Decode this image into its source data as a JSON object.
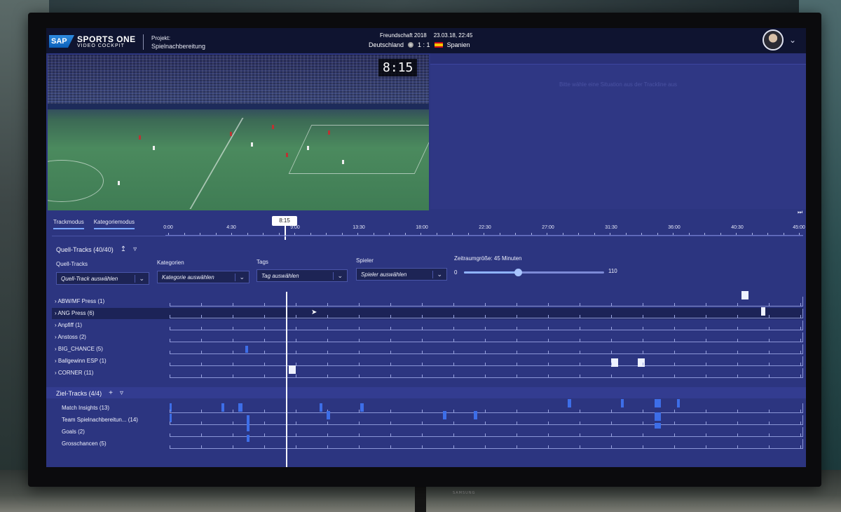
{
  "app": {
    "logo": "SAP",
    "name_line1": "SPORTS ONE",
    "name_line2": "VIDEO COCKPIT",
    "project_label": "Projekt:",
    "project_name": "Spielnachbereitung"
  },
  "match": {
    "competition": "Freundschaft 2018",
    "datetime": "23.03.18, 22:45",
    "home": "Deutschland",
    "score": "1 : 1",
    "away": "Spanien"
  },
  "video": {
    "clock": "8:15"
  },
  "right_panel": {
    "hint": "Bitte wähle eine Situation aus der Trackline aus"
  },
  "modes": [
    {
      "label": "Trackmodus",
      "active": true
    },
    {
      "label": "Kategoriemodus",
      "active": false
    }
  ],
  "timeline": {
    "playhead": "8:15",
    "ticks": [
      "0:00",
      "4:30",
      "9:00",
      "13:30",
      "18:00",
      "22:30",
      "27:00",
      "31:30",
      "36:00",
      "40:30",
      "45:00"
    ]
  },
  "quell": {
    "heading": "Quell-Tracks (40/40)",
    "filters": {
      "quell_label": "Quell-Tracks",
      "quell_value": "Quell-Track auswählen",
      "kategorien_label": "Kategorien",
      "kategorien_value": "Kategorie auswählen",
      "tags_label": "Tags",
      "tags_value": "Tag auswählen",
      "spieler_label": "Spieler",
      "spieler_value": "Spieler auswählen",
      "range_label": "Zeitraumgröße:",
      "range_value": "45 Minuten",
      "range_min": "0",
      "range_max": "110"
    },
    "tracks": [
      {
        "label": "ABW/MF Press",
        "count": "(1)"
      },
      {
        "label": "ANG Press",
        "count": "(6)"
      },
      {
        "label": "Anpfiff",
        "count": "(1)"
      },
      {
        "label": "Anstoss",
        "count": "(2)"
      },
      {
        "label": "BIG_CHANCE",
        "count": "(5)"
      },
      {
        "label": "Ballgewinn ESP",
        "count": "(1)"
      },
      {
        "label": "CORNER",
        "count": "(11)"
      }
    ]
  },
  "ziel": {
    "heading": "Ziel-Tracks (4/4)",
    "tracks": [
      {
        "label": "Match Insights",
        "count": "(13)"
      },
      {
        "label": "Team Spielnachbereitun...",
        "count": "(14)"
      },
      {
        "label": "Goals",
        "count": "(2)"
      },
      {
        "label": "Grosschancen",
        "count": "(5)"
      }
    ]
  },
  "colors": {
    "screen_bg": "#2c3580",
    "header_bg": "#0f1430",
    "accent": "#7aa7ff",
    "ziel_event": "#3d6ee8"
  },
  "icons": {
    "upload": "upload-icon",
    "filter": "filter-icon",
    "add": "plus-icon",
    "expand": "chevron-right-icon"
  },
  "tv_brand": "SAMSUNG"
}
